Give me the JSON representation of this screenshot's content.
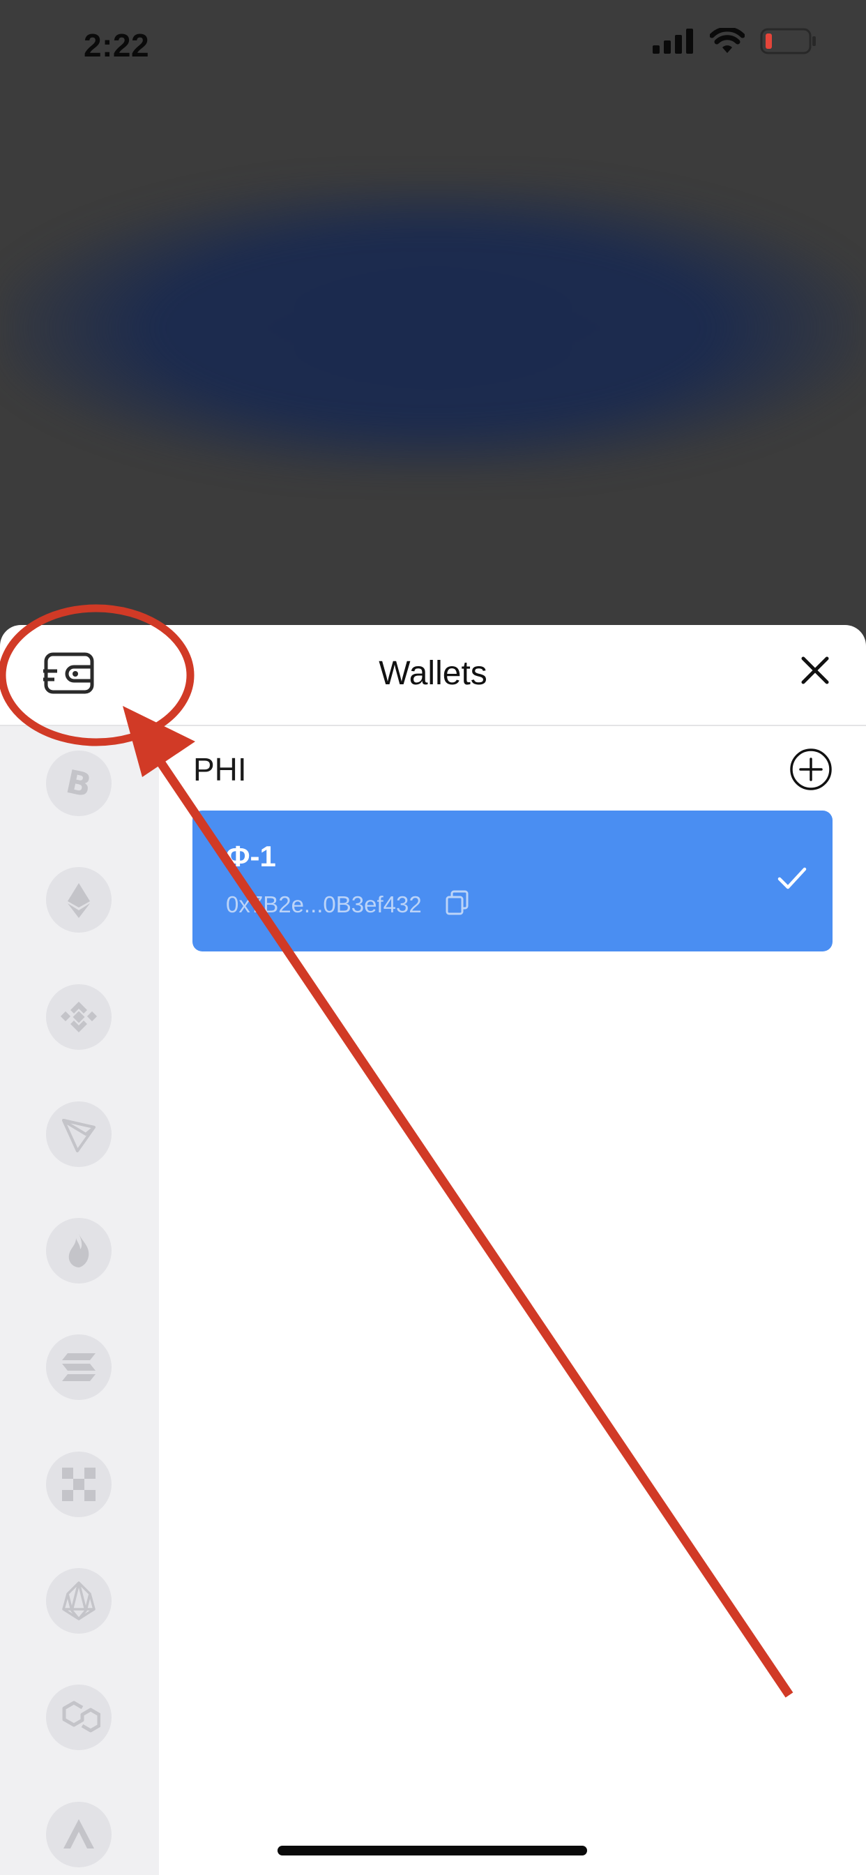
{
  "status_bar": {
    "time": "2:22",
    "battery_color": "#e5453a"
  },
  "sheet": {
    "title": "Wallets",
    "tab_icon": "wallet-icon",
    "close_icon": "close-icon"
  },
  "coins": [
    {
      "name": "bitcoin-icon"
    },
    {
      "name": "ethereum-icon"
    },
    {
      "name": "bnb-icon"
    },
    {
      "name": "tron-icon"
    },
    {
      "name": "flame-chain-icon"
    },
    {
      "name": "solana-icon"
    },
    {
      "name": "checker-chain-icon"
    },
    {
      "name": "eos-icon"
    },
    {
      "name": "polygon-icon"
    },
    {
      "name": "avalanche-icon"
    }
  ],
  "wallets": {
    "group_label": "PHI",
    "add_icon": "plus-circle-icon",
    "items": [
      {
        "name": "Φ-1",
        "address": "0x7B2e...0B3ef432",
        "selected": true,
        "copy_icon": "copy-icon",
        "check_icon": "checkmark-icon"
      }
    ]
  },
  "colors": {
    "accent": "#4a8ef2",
    "annotation": "#d13a26",
    "rail": "#f0f0f2",
    "overlay": "#3c3c3c"
  }
}
